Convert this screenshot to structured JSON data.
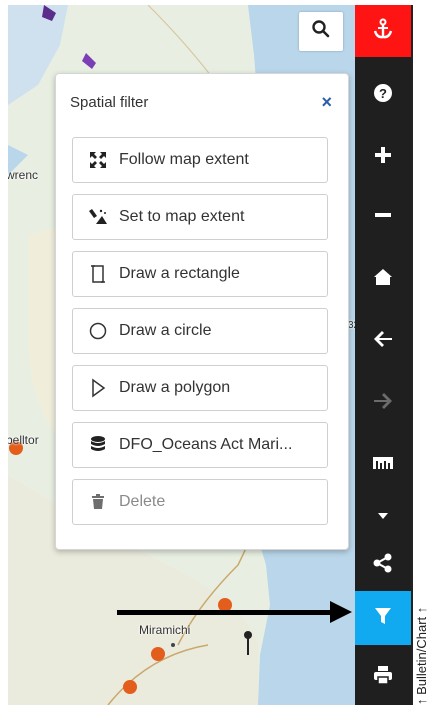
{
  "map": {
    "labels": [
      "wrenc",
      "belltor",
      "Miramichi",
      "32"
    ]
  },
  "search": {
    "icon": "search-icon"
  },
  "toolbar": {
    "items": [
      {
        "icon": "anchor-icon",
        "color": "#ff1414"
      },
      {
        "icon": "question-circle-icon"
      },
      {
        "icon": "plus-icon"
      },
      {
        "icon": "minus-icon"
      },
      {
        "icon": "home-icon"
      },
      {
        "icon": "arrow-left-icon"
      },
      {
        "icon": "arrow-right-icon"
      },
      {
        "icon": "ruler-icon"
      },
      {
        "icon": "caret-down-icon"
      },
      {
        "icon": "share-icon"
      },
      {
        "icon": "filter-icon",
        "color": "#11a9ef"
      },
      {
        "icon": "print-icon"
      }
    ]
  },
  "right_strip": {
    "text": "↑ Bulletin/Chart ↑"
  },
  "panel": {
    "title": "Spatial filter",
    "close": "×",
    "buttons": [
      {
        "label": "Follow map extent",
        "icon": "expand-arrows-icon"
      },
      {
        "label": "Set to map extent",
        "icon": "magic-wand-icon"
      },
      {
        "label": "Draw a rectangle",
        "icon": "rectangle-icon"
      },
      {
        "label": "Draw a circle",
        "icon": "circle-icon"
      },
      {
        "label": "Draw a polygon",
        "icon": "polygon-icon"
      },
      {
        "label": "DFO_Oceans Act Mari...",
        "icon": "database-icon"
      },
      {
        "label": "Delete",
        "icon": "trash-icon"
      }
    ]
  }
}
